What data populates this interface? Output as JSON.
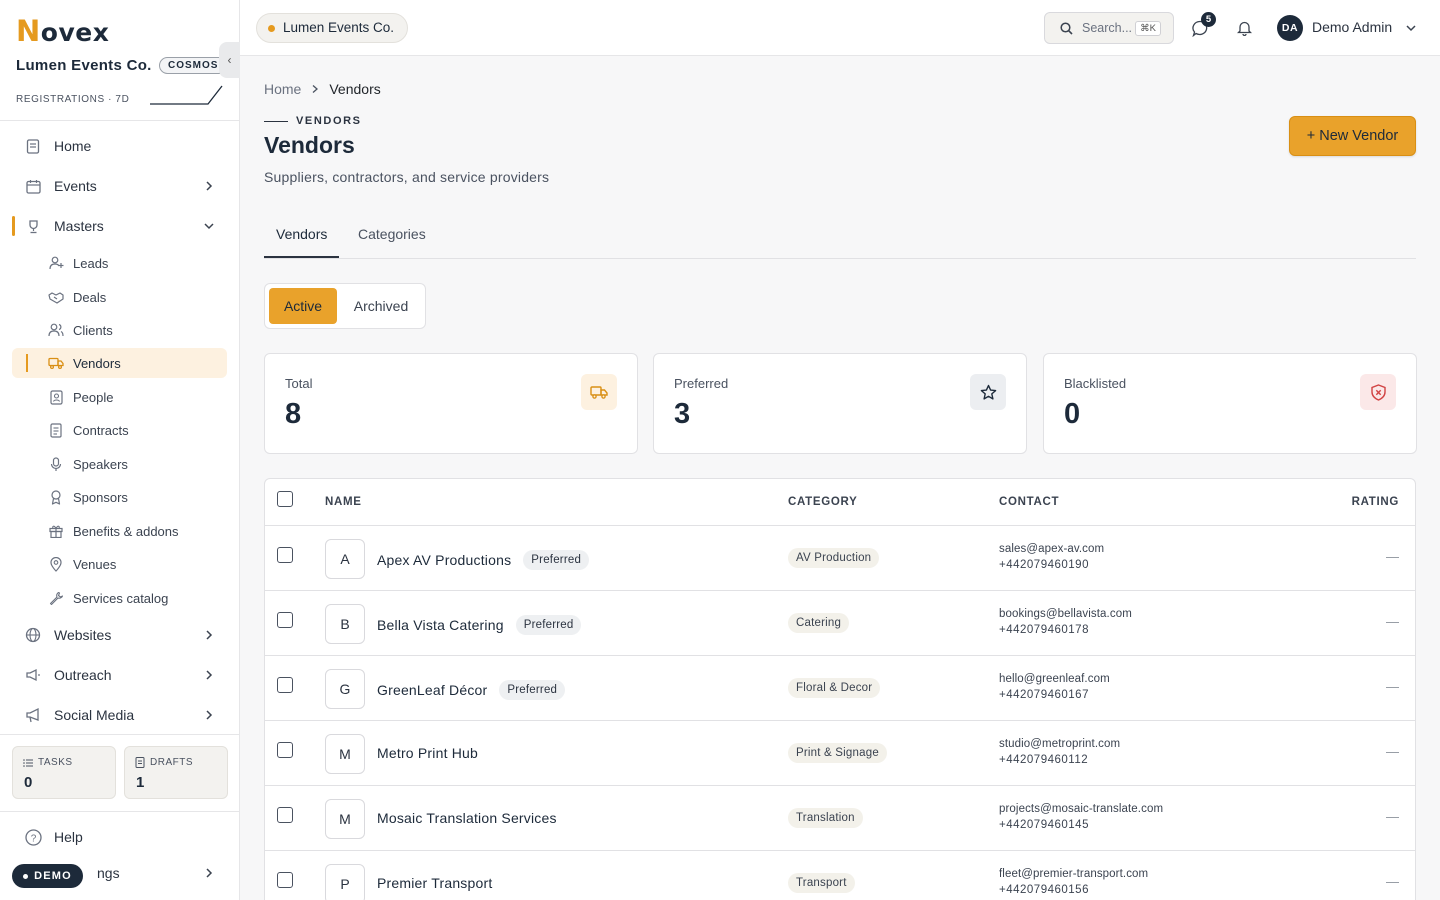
{
  "brand": {
    "logo_first": "N",
    "logo_rest": "ovex"
  },
  "org": {
    "name": "Lumen Events Co.",
    "badge": "COSMOS",
    "collapse": "‹"
  },
  "registrations": {
    "label": "REGISTRATIONS · 7D"
  },
  "nav": {
    "home": "Home",
    "events": "Events",
    "masters": "Masters",
    "masters_items": [
      {
        "label": "Leads",
        "icon": "user-plus-icon"
      },
      {
        "label": "Deals",
        "icon": "handshake-icon"
      },
      {
        "label": "Clients",
        "icon": "users-icon"
      },
      {
        "label": "Vendors",
        "icon": "truck-icon"
      },
      {
        "label": "People",
        "icon": "contact-card-icon"
      },
      {
        "label": "Contracts",
        "icon": "document-icon"
      },
      {
        "label": "Speakers",
        "icon": "microphone-icon"
      },
      {
        "label": "Sponsors",
        "icon": "medal-icon"
      },
      {
        "label": "Benefits & addons",
        "icon": "gift-icon"
      },
      {
        "label": "Venues",
        "icon": "map-pin-icon"
      },
      {
        "label": "Services catalog",
        "icon": "wrench-icon"
      }
    ],
    "websites": "Websites",
    "outreach": "Outreach",
    "social_media": "Social Media",
    "help": "Help",
    "settings_partial": "ngs"
  },
  "mini_cards": {
    "tasks": {
      "label": "TASKS",
      "value": "0"
    },
    "drafts": {
      "label": "DRAFTS",
      "value": "1"
    }
  },
  "demo_badge": "DEMO",
  "topbar": {
    "org_chip": "Lumen Events Co.",
    "search_placeholder": "Search...",
    "search_shortcut": "⌘K",
    "notification_count": "5",
    "user_initials": "DA",
    "user_name": "Demo Admin"
  },
  "breadcrumb": {
    "home": "Home",
    "current": "Vendors"
  },
  "page": {
    "eyebrow": "VENDORS",
    "title": "Vendors",
    "subtitle": "Suppliers, contractors, and service providers",
    "new_button": "+ New Vendor"
  },
  "tabs": [
    "Vendors",
    "Categories"
  ],
  "segment": {
    "active": "Active",
    "archived": "Archived"
  },
  "stats": [
    {
      "label": "Total",
      "value": "8",
      "icon": "truck-icon"
    },
    {
      "label": "Preferred",
      "value": "3",
      "icon": "star-icon"
    },
    {
      "label": "Blacklisted",
      "value": "0",
      "icon": "shield-x-icon"
    }
  ],
  "table": {
    "headers": {
      "name": "NAME",
      "category": "CATEGORY",
      "contact": "CONTACT",
      "rating": "RATING"
    },
    "rows": [
      {
        "initial": "A",
        "name": "Apex AV Productions",
        "badge": "Preferred",
        "category": "AV Production",
        "email": "sales@apex-av.com",
        "phone": "+442079460190",
        "rating": "—"
      },
      {
        "initial": "B",
        "name": "Bella Vista Catering",
        "badge": "Preferred",
        "category": "Catering",
        "email": "bookings@bellavista.com",
        "phone": "+442079460178",
        "rating": "—"
      },
      {
        "initial": "G",
        "name": "GreenLeaf Décor",
        "badge": "Preferred",
        "category": "Floral & Decor",
        "email": "hello@greenleaf.com",
        "phone": "+442079460167",
        "rating": "—"
      },
      {
        "initial": "M",
        "name": "Metro Print Hub",
        "badge": "",
        "category": "Print & Signage",
        "email": "studio@metroprint.com",
        "phone": "+442079460112",
        "rating": "—"
      },
      {
        "initial": "M",
        "name": "Mosaic Translation Services",
        "badge": "",
        "category": "Translation",
        "email": "projects@mosaic-translate.com",
        "phone": "+442079460145",
        "rating": "—"
      },
      {
        "initial": "P",
        "name": "Premier Transport",
        "badge": "",
        "category": "Transport",
        "email": "fleet@premier-transport.com",
        "phone": "+442079460156",
        "rating": "—"
      }
    ]
  },
  "colors": {
    "accent": "#e9a22b",
    "navy": "#1d2a3a",
    "active_bg": "#fdf1e0"
  }
}
